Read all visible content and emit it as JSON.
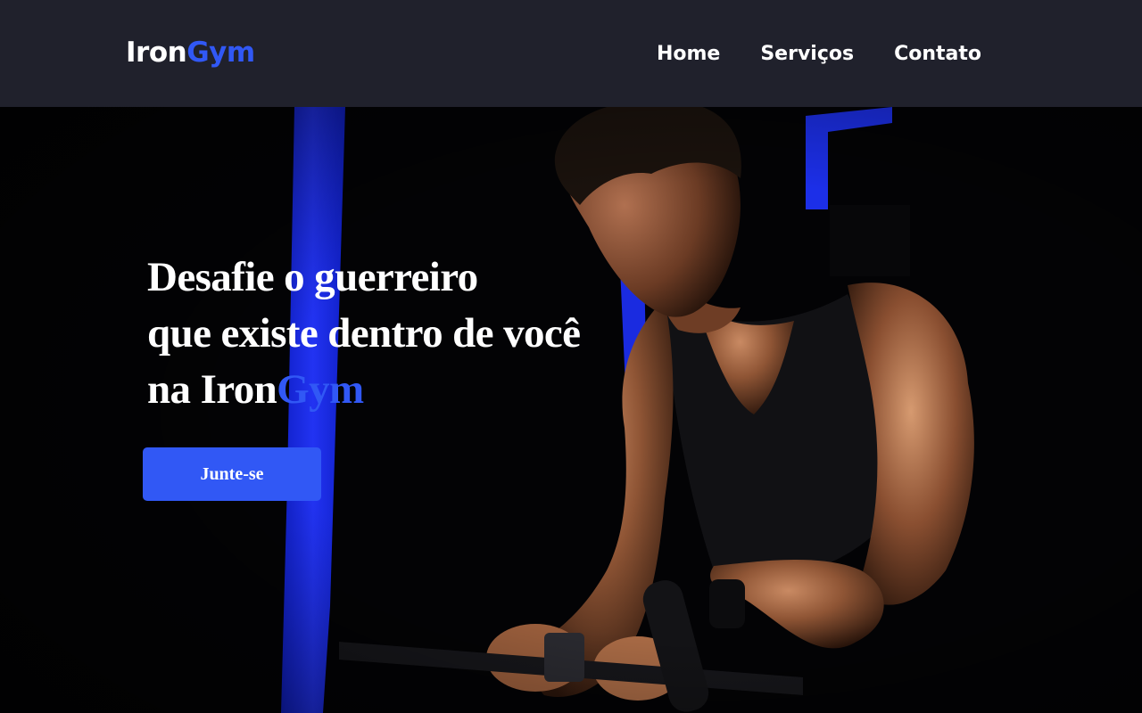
{
  "header": {
    "logo_part1": "Iron",
    "logo_part2": "Gym",
    "nav": [
      {
        "label": "Home"
      },
      {
        "label": "Serviços"
      },
      {
        "label": "Contato"
      }
    ]
  },
  "hero": {
    "title_line1": "Desafie o guerreiro",
    "title_line2": "que existe dentro de você",
    "title_line3_prefix": "na Iron",
    "title_line3_accent": "Gym",
    "cta_label": "Junte-se",
    "image_description_icon": "athlete-photo"
  },
  "colors": {
    "header_bg": "#20212c",
    "accent": "#3158f5",
    "text": "#ffffff",
    "hero_bg": "#030305"
  }
}
